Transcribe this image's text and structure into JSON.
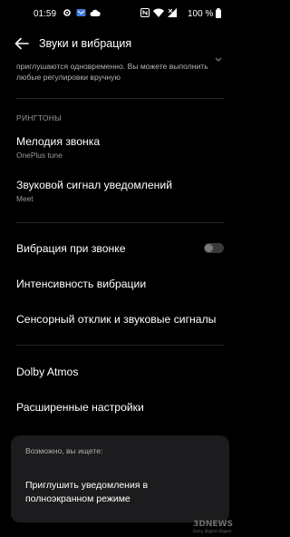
{
  "status_bar": {
    "time": "01:59",
    "battery_percent": "100 %",
    "icons": [
      "gear-icon",
      "mail-icon",
      "cloud-icon",
      "nfc-icon",
      "wifi-icon",
      "signal-icon",
      "battery-icon"
    ]
  },
  "header": {
    "title": "Звуки и вибрация"
  },
  "partial_text": "приглушаются одновременно. Вы можете выполнить любые регулировки вручную",
  "ringtones_section": {
    "label": "РИНГТОНЫ",
    "ringtone": {
      "title": "Мелодия звонка",
      "value": "OnePlus tune"
    },
    "notification": {
      "title": "Звуковой сигнал уведомлений",
      "value": "Meet"
    }
  },
  "vibration": {
    "vibrate_on_ring": {
      "title": "Вибрация при звонке",
      "enabled": false
    },
    "intensity": {
      "title": "Интенсивность вибрации"
    },
    "haptics": {
      "title": "Сенсорный отклик и звуковые сигналы"
    }
  },
  "more": {
    "dolby": {
      "title": "Dolby Atmos"
    },
    "advanced": {
      "title": "Расширенные настройки"
    }
  },
  "suggestion": {
    "header": "Возможно, вы ищете:",
    "link": "Приглушить уведомления в полноэкранном режиме"
  },
  "watermark": {
    "brand": "3DNEWS",
    "tagline": "Daily Digital Digest"
  },
  "colors": {
    "background": "#000000",
    "card": "#1c1c1e",
    "secondary_text": "#9a9a9a"
  }
}
